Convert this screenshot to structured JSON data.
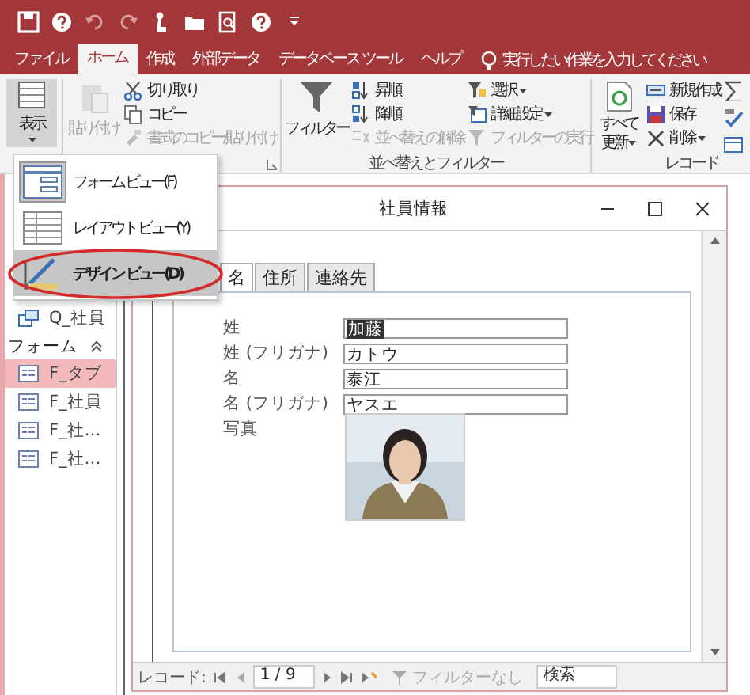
{
  "quick_access": [
    {
      "kind": "save",
      "disabled": false
    },
    {
      "kind": "help",
      "disabled": false
    },
    {
      "kind": "undo",
      "disabled": true
    },
    {
      "kind": "redo",
      "disabled": true
    },
    {
      "kind": "touch",
      "disabled": false
    },
    {
      "kind": "open",
      "disabled": false
    },
    {
      "kind": "preview",
      "disabled": false
    },
    {
      "kind": "help",
      "disabled": false
    },
    {
      "kind": "customize",
      "disabled": false
    }
  ],
  "ribbon_tabs": [
    {
      "label": "ファイル",
      "selected": false
    },
    {
      "label": "ホーム",
      "selected": true
    },
    {
      "label": "作成",
      "selected": false
    },
    {
      "label": "外部データ",
      "selected": false
    },
    {
      "label": "データベース ツール",
      "selected": false
    },
    {
      "label": "ヘルプ",
      "selected": false
    }
  ],
  "tell_me": {
    "placeholder": "実行したい作業を入力してください"
  },
  "ribbon": {
    "view": {
      "label": "表示"
    },
    "clipboard": {
      "paste": {
        "label": "貼り付け",
        "disabled": true
      },
      "commands": [
        {
          "kind": "cut",
          "label": "切り取り",
          "disabled": false
        },
        {
          "kind": "copy",
          "label": "コピー",
          "disabled": false
        },
        {
          "kind": "format-painter",
          "label": "書式のコピー/貼り付け",
          "disabled": true
        }
      ]
    },
    "sort_filter": {
      "title": "並べ替えとフィルター",
      "filter": {
        "label": "フィルター"
      },
      "commands": [
        {
          "kind": "ascending",
          "label": "昇順",
          "disabled": false,
          "dropdown": false
        },
        {
          "kind": "descending",
          "label": "降順",
          "disabled": false,
          "dropdown": false
        },
        {
          "kind": "clear-sort",
          "label": "並べ替えの解除",
          "disabled": true,
          "dropdown": false
        },
        {
          "kind": "selection",
          "label": "選択",
          "disabled": false,
          "dropdown": true
        },
        {
          "kind": "advanced",
          "label": "詳細設定",
          "disabled": false,
          "dropdown": true
        },
        {
          "kind": "toggle-filter",
          "label": "フィルターの実行",
          "disabled": true,
          "dropdown": false
        }
      ]
    },
    "records": {
      "title": "レコード",
      "refresh": {
        "label": "すべて更新"
      },
      "commands": [
        {
          "kind": "new",
          "label": "新規作成",
          "disabled": false,
          "dropdown": false
        },
        {
          "kind": "save",
          "label": "保存",
          "disabled": false,
          "dropdown": false
        },
        {
          "kind": "delete",
          "label": "削除",
          "disabled": false,
          "dropdown": true
        }
      ],
      "more_tools": [
        {
          "kind": "sum"
        },
        {
          "kind": "spelling"
        },
        {
          "kind": "more"
        }
      ]
    }
  },
  "view_menu": {
    "items": [
      {
        "kind": "form",
        "label": "フォーム ビュー(F)",
        "current": true,
        "hovered": false,
        "circled": false
      },
      {
        "kind": "layout",
        "label": "レイアウト ビュー(Y)",
        "current": false,
        "hovered": false,
        "circled": false
      },
      {
        "kind": "design",
        "label": "デザイン ビュー(D)",
        "current": false,
        "hovered": true,
        "circled": true
      }
    ]
  },
  "nav_pane": {
    "items": [
      {
        "kind": "query",
        "label": "Q_社員",
        "selected": false
      },
      {
        "kind": "header",
        "label": "フォーム",
        "expanded": true
      },
      {
        "kind": "form",
        "label": "F_タブ",
        "selected": true
      },
      {
        "kind": "form",
        "label": "F_社員",
        "selected": false
      },
      {
        "kind": "form",
        "label": "F_社…",
        "selected": false
      },
      {
        "kind": "form",
        "label": "F_社…",
        "selected": false
      }
    ]
  },
  "form_window": {
    "title": "社員情報",
    "tabs": [
      {
        "label": "名",
        "selected": true
      },
      {
        "label": "住所",
        "selected": false
      },
      {
        "label": "連絡先",
        "selected": false
      }
    ],
    "fields": [
      {
        "label": "姓",
        "value": "加藤",
        "selected": true
      },
      {
        "label": "姓 (フリガナ)",
        "value": "カトウ",
        "selected": false
      },
      {
        "label": "名",
        "value": "泰江",
        "selected": false
      },
      {
        "label": "名 (フリガナ)",
        "value": "ヤスエ",
        "selected": false
      }
    ],
    "photo": {
      "label": "写真",
      "kind": "picture"
    },
    "record_nav": {
      "label": "レコード:",
      "position": "1 / 9",
      "filter_status": "フィルターなし",
      "search": {
        "placeholder": "検索"
      }
    }
  }
}
